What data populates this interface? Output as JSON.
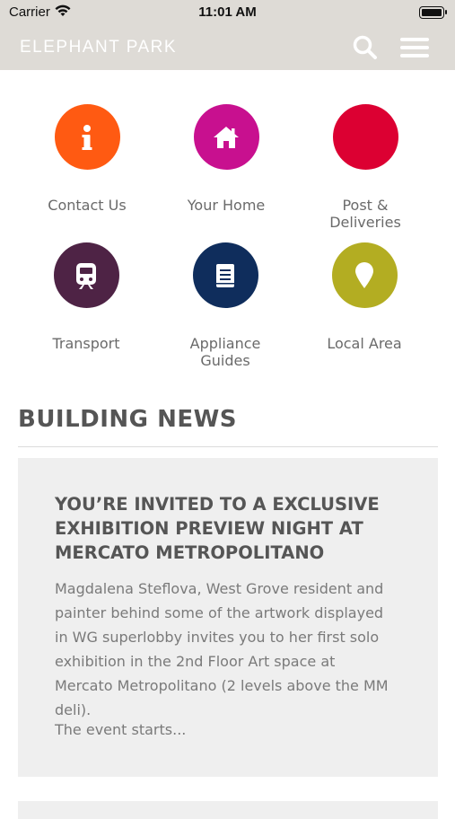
{
  "status_bar": {
    "carrier": "Carrier",
    "time": "11:01 AM"
  },
  "header": {
    "brand": "ELEPHANT PARK"
  },
  "tiles": [
    {
      "label": "Contact Us",
      "icon": "info-icon",
      "color": "#ff5a12"
    },
    {
      "label": "Your Home",
      "icon": "home-icon",
      "color": "#c8108f"
    },
    {
      "label": "Post & Deliveries",
      "icon": "post-icon",
      "color": "#dc0032"
    },
    {
      "label": "Transport",
      "icon": "train-icon",
      "color": "#4e2345"
    },
    {
      "label": "Appliance Guides",
      "icon": "book-icon",
      "color": "#0f2d5c"
    },
    {
      "label": "Local Area",
      "icon": "location-pin-icon",
      "color": "#b3ad22"
    }
  ],
  "news": {
    "section_title": "BUILDING NEWS",
    "items": [
      {
        "headline": "YOU’RE INVITED TO A EXCLUSIVE EXHIBITION PREVIEW NIGHT AT MERCATO METROPOLITANO",
        "body": "Magdalena Steflova, West Grove resident and painter behind some of the artwork displayed in WG superlobby invites you to her first solo exhibition in the 2nd Floor Art space at Mercato Metropolitano (2 levels above the MM deli).",
        "excerpt_end": "The event starts..."
      }
    ]
  }
}
